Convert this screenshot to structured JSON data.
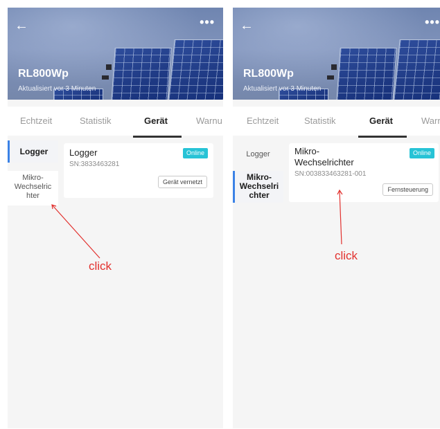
{
  "left_screen": {
    "header": {
      "title": "RL800Wp",
      "subtitle": "Aktualisiert vor 3 Minuten",
      "back_icon": "←",
      "more_icon": "•••"
    },
    "tabs": [
      "Echtzeit",
      "Statistik",
      "Gerät",
      "Warnu"
    ],
    "active_tab": "Gerät",
    "sidebar": {
      "item1": "Logger",
      "item2": "Mikro-\nWechselric\nhter",
      "active": "Logger"
    },
    "card": {
      "title": "Logger",
      "sn": "SN:3833463281",
      "status": "Online",
      "button": "Gerät vernetzt"
    },
    "annotation": "click"
  },
  "right_screen": {
    "header": {
      "title": "RL800Wp",
      "subtitle": "Aktualisiert vor 3 Minuten",
      "back_icon": "←",
      "more_icon": "•••"
    },
    "tabs": [
      "Echtzeit",
      "Statistik",
      "Gerät",
      "Warr"
    ],
    "active_tab": "Gerät",
    "sidebar": {
      "item1": "Logger",
      "item2": "Mikro-\nWechselri\nchter",
      "active": "Mikro-Wechselrichter"
    },
    "card": {
      "title": "Mikro-\nWechselrichter",
      "sn": "SN:003833463281-001",
      "status": "Online",
      "button": "Fernsteuerung"
    },
    "annotation": "click"
  },
  "colors": {
    "accent_blue": "#3b82e6",
    "online_badge": "#27c3d6",
    "annotation_red": "#e2302d",
    "background": "#f5f5f5"
  }
}
